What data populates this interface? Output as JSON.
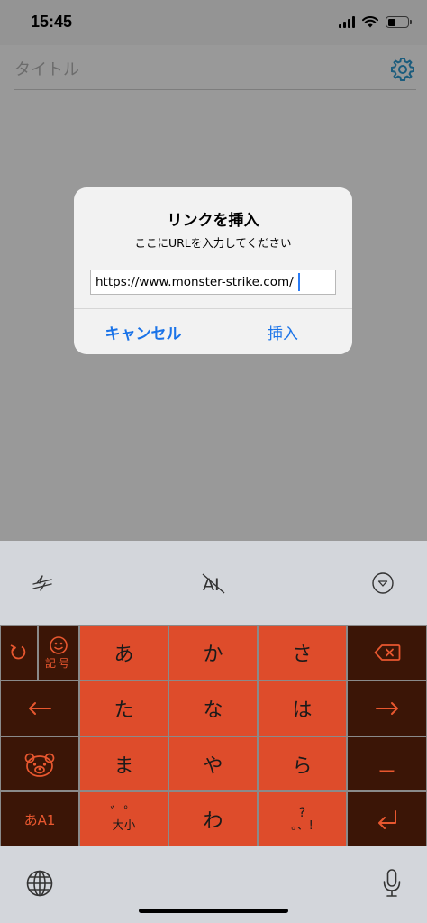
{
  "status": {
    "time": "15:45"
  },
  "title_field": {
    "placeholder": "タイトル"
  },
  "dialog": {
    "title": "リンクを挿入",
    "message": "ここにURLを入力してください",
    "url_value": "https://www.monster-strike.com/",
    "cancel_label": "キャンセル",
    "insert_label": "挿入"
  },
  "toolbar": {
    "ai_label": "AI"
  },
  "keyboard": {
    "kigo_label": "記号",
    "mode_label": "あA1",
    "rows": [
      [
        "あ",
        "か",
        "さ"
      ],
      [
        "た",
        "な",
        "は"
      ],
      [
        "ま",
        "や",
        "ら"
      ]
    ],
    "wa": "わ",
    "dakuten_top": "゛゜",
    "dakuten_bottom": "大小",
    "punct_top": "?",
    "punct_bottom": "。、!",
    "long_vowel": "ー"
  },
  "colors": {
    "key_main": "#de4c2b",
    "key_side": "#3b1506",
    "accent_blue": "#1a73e8"
  }
}
